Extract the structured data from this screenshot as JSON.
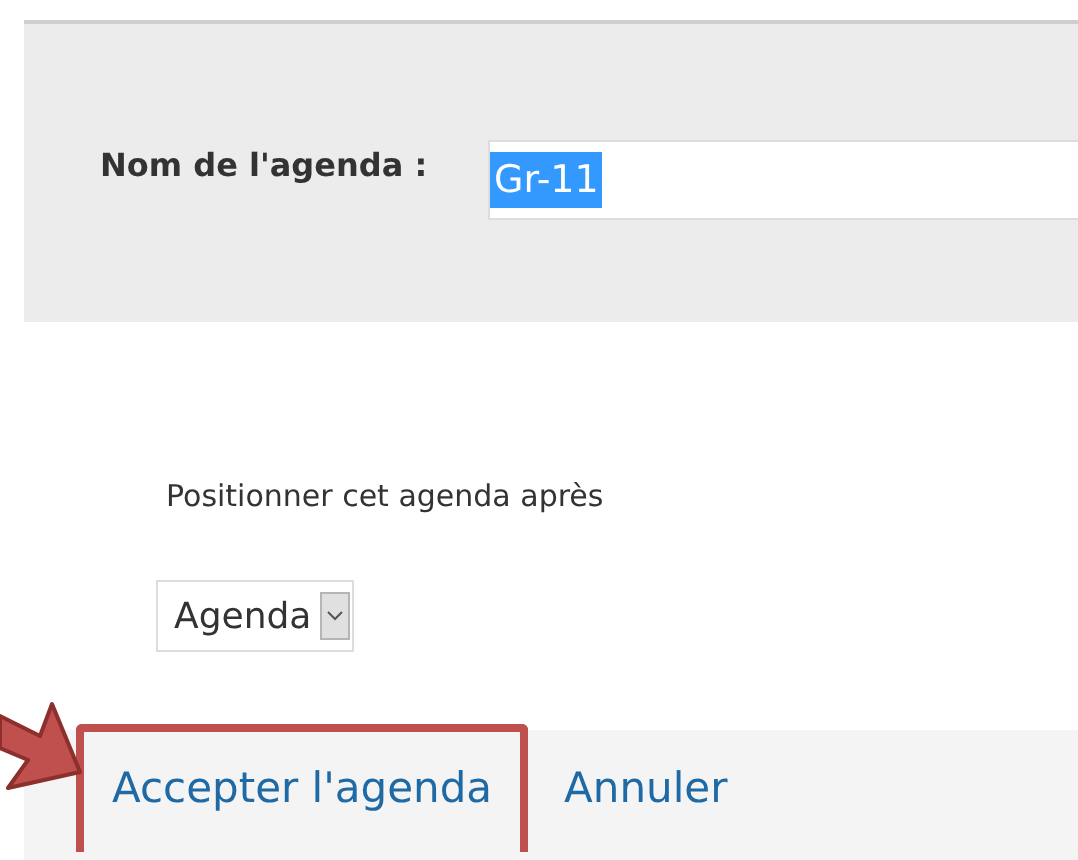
{
  "form": {
    "label": "Nom de l'agenda :",
    "value": "Gr-11",
    "value_selected": true
  },
  "position": {
    "label": "Positionner cet agenda après",
    "select_value": "Agenda"
  },
  "actions": [
    {
      "label": "Accepter l'agenda",
      "highlighted": true
    },
    {
      "label": "Annuler",
      "highlighted": false
    }
  ]
}
